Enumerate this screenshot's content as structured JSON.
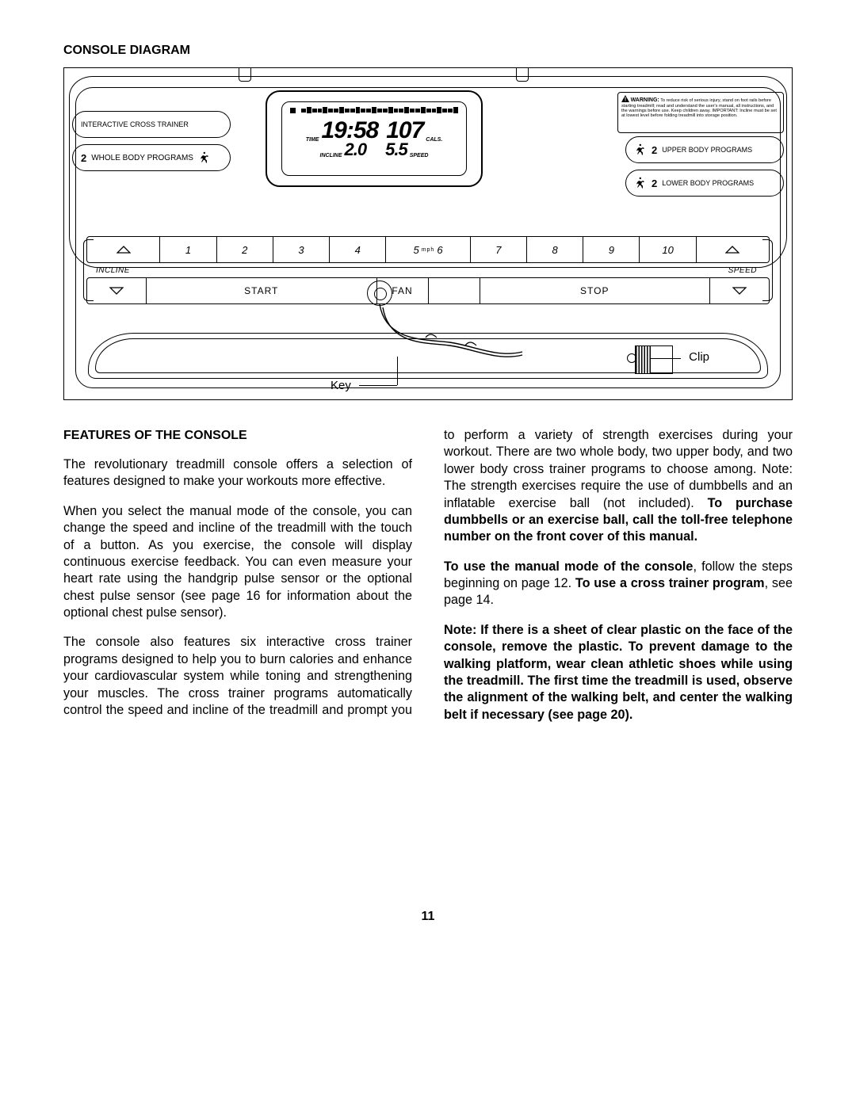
{
  "sections": {
    "diagram_title": "CONSOLE DIAGRAM",
    "features_title": "FEATURES OF THE CONSOLE"
  },
  "console": {
    "left_labels": {
      "interactive": "INTERACTIVE CROSS TRAINER",
      "whole_body_num": "2",
      "whole_body": "WHOLE BODY PROGRAMS"
    },
    "right_labels": {
      "upper_num": "2",
      "upper": "UPPER BODY PROGRAMS",
      "lower_num": "2",
      "lower": "LOWER BODY PROGRAMS"
    },
    "warning_title": "WARNING:",
    "warning_text": "To reduce risk of serious injury, stand on foot rails before starting treadmill; read and understand the user's manual, all instructions, and the warnings before use. Keep children away. IMPORTANT: Incline must be set at lowest level before folding treadmill into storage position.",
    "display": {
      "time_label": "TIME",
      "time_value": "19:58",
      "cals_label": "CALS.",
      "cals_value": "107",
      "incline_label": "INCLINE",
      "incline_value": "2.0",
      "speed_label": "SPEED",
      "speed_value": "5.5"
    },
    "keypad": [
      "1",
      "2",
      "3",
      "4",
      "5",
      "6",
      "7",
      "8",
      "9",
      "10"
    ],
    "mph": "mph",
    "row2": {
      "incline": "INCLINE",
      "start": "START",
      "fan": "FAN",
      "stop": "STOP",
      "speed": "SPEED"
    },
    "callouts": {
      "key": "Key",
      "clip": "Clip"
    }
  },
  "body": {
    "p1": "The revolutionary treadmill console offers a selection of features designed to make your workouts more effective.",
    "p2": "When you select the manual mode of the console, you can change the speed and incline of the treadmill with the touch of a button. As you exercise, the console will display continuous exercise feedback. You can even measure your heart rate using the handgrip pulse sensor or the optional chest pulse sensor (see page 16 for information about the optional chest pulse sensor).",
    "p3a": "The console also features six interactive cross trainer programs designed to help you to burn calories and enhance your cardiovascular system while toning and strengthening your muscles. The cross trainer programs automatically control the speed and incline of the treadmill and prompt you to perform a variety of ",
    "p3b": "strength exercises during your workout. There are two whole body, two upper body, and two lower body cross trainer programs to choose among. Note: The strength exercises require the use of dumbbells and an inflatable exercise ball (not included). ",
    "p3c_bold": "To purchase dumbbells or an exercise ball, call the toll-free telephone number on the front cover of this manual.",
    "p4a_bold": "To use the manual mode of the console",
    "p4b": ", follow the steps beginning on page 12. ",
    "p4c_bold": "To use a cross trainer program",
    "p4d": ", see page 14.",
    "p5_bold": "Note: If there is a sheet of clear plastic on the face of the console, remove the plastic. To prevent damage to the walking platform, wear clean athletic shoes while using the treadmill. The first time the treadmill is used, observe the alignment of the walking belt, and center the walking belt if necessary (see page 20)."
  },
  "page_number": "11"
}
